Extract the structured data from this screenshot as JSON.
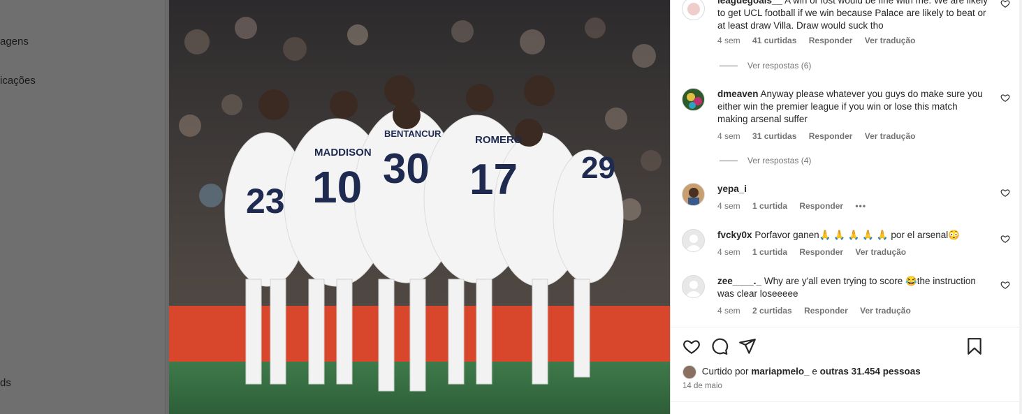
{
  "left_nav": {
    "items": [
      {
        "label": "agens"
      },
      {
        "label": "icações"
      },
      {
        "label": "ds"
      }
    ]
  },
  "post_image": {
    "jerseys": [
      {
        "name": "MADDISON",
        "number": "10"
      },
      {
        "name": "BENTANCUR",
        "number": "30"
      },
      {
        "name": "ROMERO",
        "number": "17"
      },
      {
        "name": "",
        "number": "23"
      },
      {
        "name": "",
        "number": "29"
      }
    ]
  },
  "comments": [
    {
      "username": "leaguegoals__",
      "text": "A win or lost would be fine with me. We are likely to get UCL football if we win because Palace are likely to beat or at least draw Villa. Draw would suck tho",
      "time": "4 sem",
      "likes": "41 curtidas",
      "reply": "Responder",
      "translate": "Ver tradução",
      "view_replies": "Ver respostas (6)",
      "avatar_color": "#ffffff"
    },
    {
      "username": "dmeaven",
      "text": "Anyway please whatever you guys do make sure you either win the premier league if you win or lose this match making arsenal suffer",
      "time": "4 sem",
      "likes": "31 curtidas",
      "reply": "Responder",
      "translate": "Ver tradução",
      "view_replies": "Ver respostas (4)",
      "avatar_color": "#2f5a2a"
    },
    {
      "username": "yepa_i",
      "text": "",
      "time": "4 sem",
      "likes": "1 curtida",
      "reply": "Responder",
      "more": "•••",
      "avatar_color": "#c8a070"
    },
    {
      "username": "fvcky0x",
      "text": "Porfavor ganen🙏 🙏 🙏 🙏 🙏  por el arsenal😳",
      "time": "4 sem",
      "likes": "1 curtida",
      "reply": "Responder",
      "translate": "Ver tradução",
      "avatar_color": "#d6d6d6"
    },
    {
      "username": "zee____._",
      "text": "Why are y'all even trying to score 😂the instruction was clear loseeeee",
      "time": "4 sem",
      "likes": "2 curtidas",
      "reply": "Responder",
      "translate": "Ver tradução",
      "avatar_color": "#d6d6d6"
    }
  ],
  "likes": {
    "prefix": "Curtido por",
    "user": "mariapmelo_",
    "connector": "e",
    "others": "outras 31.454 pessoas"
  },
  "date": "14 de maio",
  "icons": [
    "heart-icon",
    "comment-icon",
    "share-icon",
    "bookmark-icon"
  ]
}
